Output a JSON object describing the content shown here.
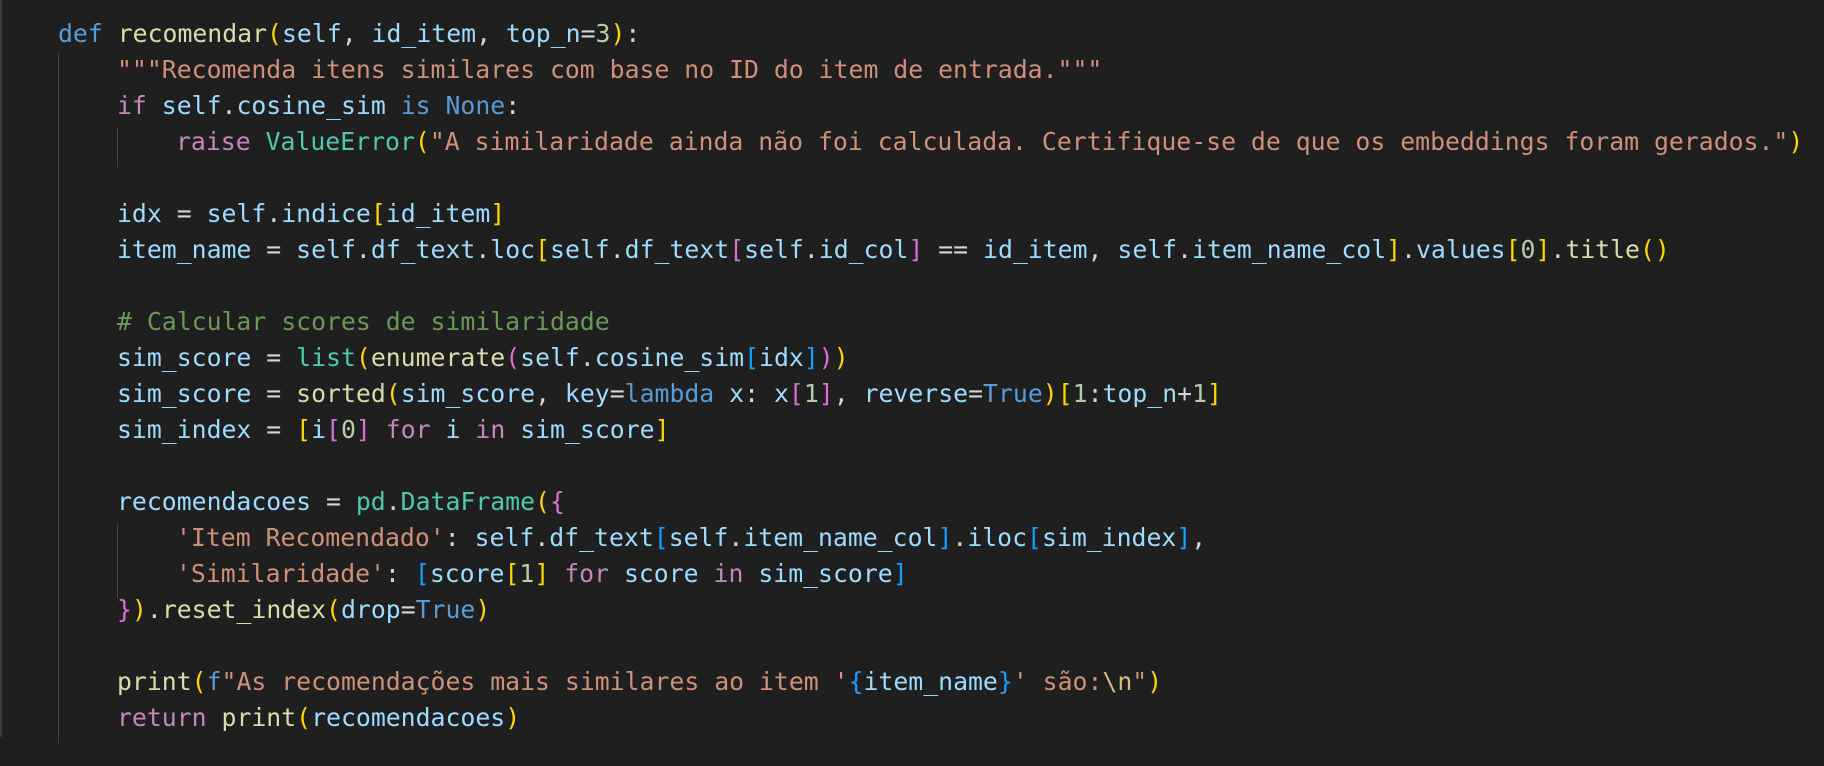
{
  "editor": {
    "language": "python",
    "colors": {
      "background": "#1f1f1f",
      "keyword": "#569cd6",
      "control": "#c586c0",
      "function": "#dcdcaa",
      "variable": "#9cdcfe",
      "string": "#ce9178",
      "number": "#b5cea8",
      "class": "#4ec9b0",
      "comment": "#6a9955",
      "bracket_level_1": "#ffd700",
      "bracket_level_2": "#da70d6",
      "bracket_level_3": "#179fff"
    },
    "lines": [
      {
        "indent": 0,
        "tokens": [
          [
            "kw",
            "def"
          ],
          [
            "op",
            " "
          ],
          [
            "fn",
            "recomendar"
          ],
          [
            "b1",
            "("
          ],
          [
            "var",
            "self"
          ],
          [
            "op",
            ", "
          ],
          [
            "var",
            "id_item"
          ],
          [
            "op",
            ", "
          ],
          [
            "var",
            "top_n"
          ],
          [
            "op",
            "="
          ],
          [
            "num",
            "3"
          ],
          [
            "b1",
            ")"
          ],
          [
            "op",
            ":"
          ]
        ]
      },
      {
        "indent": 1,
        "tokens": [
          [
            "str",
            "\"\"\"Recomenda itens similares com base no ID do item de entrada.\"\"\""
          ]
        ]
      },
      {
        "indent": 1,
        "tokens": [
          [
            "ctl",
            "if"
          ],
          [
            "op",
            " "
          ],
          [
            "var",
            "self"
          ],
          [
            "op",
            "."
          ],
          [
            "var",
            "cosine_sim"
          ],
          [
            "op",
            " "
          ],
          [
            "kw",
            "is"
          ],
          [
            "op",
            " "
          ],
          [
            "kw",
            "None"
          ],
          [
            "op",
            ":"
          ]
        ]
      },
      {
        "indent": 2,
        "tokens": [
          [
            "ctl",
            "raise"
          ],
          [
            "op",
            " "
          ],
          [
            "cls",
            "ValueError"
          ],
          [
            "b1",
            "("
          ],
          [
            "str",
            "\"A similaridade ainda não foi calculada. Certifique-se de que os embeddings foram gerados.\""
          ],
          [
            "b1",
            ")"
          ]
        ]
      },
      {
        "indent": 0,
        "tokens": []
      },
      {
        "indent": 1,
        "tokens": [
          [
            "var",
            "idx"
          ],
          [
            "op",
            " = "
          ],
          [
            "var",
            "self"
          ],
          [
            "op",
            "."
          ],
          [
            "var",
            "indice"
          ],
          [
            "b1",
            "["
          ],
          [
            "var",
            "id_item"
          ],
          [
            "b1",
            "]"
          ]
        ]
      },
      {
        "indent": 1,
        "tokens": [
          [
            "var",
            "item_name"
          ],
          [
            "op",
            " = "
          ],
          [
            "var",
            "self"
          ],
          [
            "op",
            "."
          ],
          [
            "var",
            "df_text"
          ],
          [
            "op",
            "."
          ],
          [
            "var",
            "loc"
          ],
          [
            "b1",
            "["
          ],
          [
            "var",
            "self"
          ],
          [
            "op",
            "."
          ],
          [
            "var",
            "df_text"
          ],
          [
            "b2",
            "["
          ],
          [
            "var",
            "self"
          ],
          [
            "op",
            "."
          ],
          [
            "var",
            "id_col"
          ],
          [
            "b2",
            "]"
          ],
          [
            "op",
            " == "
          ],
          [
            "var",
            "id_item"
          ],
          [
            "op",
            ", "
          ],
          [
            "var",
            "self"
          ],
          [
            "op",
            "."
          ],
          [
            "var",
            "item_name_col"
          ],
          [
            "b1",
            "]"
          ],
          [
            "op",
            "."
          ],
          [
            "var",
            "values"
          ],
          [
            "b1",
            "["
          ],
          [
            "num",
            "0"
          ],
          [
            "b1",
            "]"
          ],
          [
            "op",
            "."
          ],
          [
            "fn",
            "title"
          ],
          [
            "b1",
            "()"
          ]
        ]
      },
      {
        "indent": 0,
        "tokens": []
      },
      {
        "indent": 1,
        "tokens": [
          [
            "cmt",
            "# Calcular scores de similaridade"
          ]
        ]
      },
      {
        "indent": 1,
        "tokens": [
          [
            "var",
            "sim_score"
          ],
          [
            "op",
            " = "
          ],
          [
            "cls",
            "list"
          ],
          [
            "b1",
            "("
          ],
          [
            "fn",
            "enumerate"
          ],
          [
            "b2",
            "("
          ],
          [
            "var",
            "self"
          ],
          [
            "op",
            "."
          ],
          [
            "var",
            "cosine_sim"
          ],
          [
            "b3",
            "["
          ],
          [
            "var",
            "idx"
          ],
          [
            "b3",
            "]"
          ],
          [
            "b2",
            ")"
          ],
          [
            "b1",
            ")"
          ]
        ]
      },
      {
        "indent": 1,
        "tokens": [
          [
            "var",
            "sim_score"
          ],
          [
            "op",
            " = "
          ],
          [
            "fn",
            "sorted"
          ],
          [
            "b1",
            "("
          ],
          [
            "var",
            "sim_score"
          ],
          [
            "op",
            ", "
          ],
          [
            "var",
            "key"
          ],
          [
            "op",
            "="
          ],
          [
            "kw",
            "lambda"
          ],
          [
            "op",
            " "
          ],
          [
            "var",
            "x"
          ],
          [
            "op",
            ": "
          ],
          [
            "var",
            "x"
          ],
          [
            "b2",
            "["
          ],
          [
            "num",
            "1"
          ],
          [
            "b2",
            "]"
          ],
          [
            "op",
            ", "
          ],
          [
            "var",
            "reverse"
          ],
          [
            "op",
            "="
          ],
          [
            "kw",
            "True"
          ],
          [
            "b1",
            ")"
          ],
          [
            "b1",
            "["
          ],
          [
            "num",
            "1"
          ],
          [
            "op",
            ":"
          ],
          [
            "var",
            "top_n"
          ],
          [
            "op",
            "+"
          ],
          [
            "num",
            "1"
          ],
          [
            "b1",
            "]"
          ]
        ]
      },
      {
        "indent": 1,
        "tokens": [
          [
            "var",
            "sim_index"
          ],
          [
            "op",
            " = "
          ],
          [
            "b1",
            "["
          ],
          [
            "var",
            "i"
          ],
          [
            "b2",
            "["
          ],
          [
            "num",
            "0"
          ],
          [
            "b2",
            "]"
          ],
          [
            "op",
            " "
          ],
          [
            "ctl",
            "for"
          ],
          [
            "op",
            " "
          ],
          [
            "var",
            "i"
          ],
          [
            "op",
            " "
          ],
          [
            "ctl",
            "in"
          ],
          [
            "op",
            " "
          ],
          [
            "var",
            "sim_score"
          ],
          [
            "b1",
            "]"
          ]
        ]
      },
      {
        "indent": 0,
        "tokens": []
      },
      {
        "indent": 1,
        "tokens": [
          [
            "var",
            "recomendacoes"
          ],
          [
            "op",
            " = "
          ],
          [
            "cls",
            "pd"
          ],
          [
            "op",
            "."
          ],
          [
            "cls",
            "DataFrame"
          ],
          [
            "b1",
            "("
          ],
          [
            "b2",
            "{"
          ]
        ]
      },
      {
        "indent": 2,
        "tokens": [
          [
            "str",
            "'Item Recomendado'"
          ],
          [
            "op",
            ": "
          ],
          [
            "var",
            "self"
          ],
          [
            "op",
            "."
          ],
          [
            "var",
            "df_text"
          ],
          [
            "b3",
            "["
          ],
          [
            "var",
            "self"
          ],
          [
            "op",
            "."
          ],
          [
            "var",
            "item_name_col"
          ],
          [
            "b3",
            "]"
          ],
          [
            "op",
            "."
          ],
          [
            "var",
            "iloc"
          ],
          [
            "b3",
            "["
          ],
          [
            "var",
            "sim_index"
          ],
          [
            "b3",
            "]"
          ],
          [
            "op",
            ","
          ]
        ]
      },
      {
        "indent": 2,
        "tokens": [
          [
            "str",
            "'Similaridade'"
          ],
          [
            "op",
            ": "
          ],
          [
            "b3",
            "["
          ],
          [
            "var",
            "score"
          ],
          [
            "b1",
            "["
          ],
          [
            "num",
            "1"
          ],
          [
            "b1",
            "]"
          ],
          [
            "op",
            " "
          ],
          [
            "ctl",
            "for"
          ],
          [
            "op",
            " "
          ],
          [
            "var",
            "score"
          ],
          [
            "op",
            " "
          ],
          [
            "ctl",
            "in"
          ],
          [
            "op",
            " "
          ],
          [
            "var",
            "sim_score"
          ],
          [
            "b3",
            "]"
          ]
        ]
      },
      {
        "indent": 1,
        "tokens": [
          [
            "b2",
            "}"
          ],
          [
            "b1",
            ")"
          ],
          [
            "op",
            "."
          ],
          [
            "fn",
            "reset_index"
          ],
          [
            "b1",
            "("
          ],
          [
            "var",
            "drop"
          ],
          [
            "op",
            "="
          ],
          [
            "kw",
            "True"
          ],
          [
            "b1",
            ")"
          ]
        ]
      },
      {
        "indent": 0,
        "tokens": []
      },
      {
        "indent": 1,
        "tokens": [
          [
            "fn",
            "print"
          ],
          [
            "b1",
            "("
          ],
          [
            "kw",
            "f"
          ],
          [
            "str",
            "\"As recomendações mais similares ao item '"
          ],
          [
            "b3",
            "{"
          ],
          [
            "var",
            "item_name"
          ],
          [
            "b3",
            "}"
          ],
          [
            "str",
            "' são:"
          ],
          [
            "esc",
            "\\n"
          ],
          [
            "str",
            "\""
          ],
          [
            "b1",
            ")"
          ]
        ]
      },
      {
        "indent": 1,
        "tokens": [
          [
            "ctl",
            "return"
          ],
          [
            "op",
            " "
          ],
          [
            "fn",
            "print"
          ],
          [
            "b1",
            "("
          ],
          [
            "var",
            "recomendacoes"
          ],
          [
            "b1",
            ")"
          ]
        ]
      }
    ]
  }
}
